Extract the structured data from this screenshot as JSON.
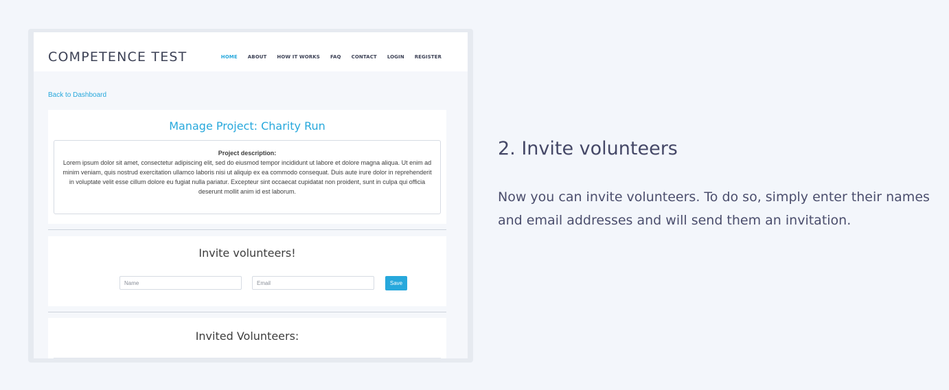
{
  "screenshot": {
    "logo": "COMPETENCE TEST",
    "nav": [
      "HOME",
      "ABOUT",
      "HOW IT WORKS",
      "FAQ",
      "CONTACT",
      "LOGIN",
      "REGISTER"
    ],
    "active_nav": "HOME",
    "back_link": "Back to Dashboard",
    "project": {
      "title": "Manage Project: Charity Run",
      "description_heading": "Project description:",
      "description_text": "Lorem ipsum dolor sit amet, consectetur adipiscing elit, sed do eiusmod tempor incididunt ut labore et dolore magna aliqua. Ut enim ad minim veniam, quis nostrud exercitation ullamco laboris nisi ut aliquip ex ea commodo consequat. Duis aute irure dolor in reprehenderit in voluptate velit esse cillum dolore eu fugiat nulla pariatur. Excepteur sint occaecat cupidatat non proident, sunt in culpa qui officia deserunt mollit anim id est laborum."
    },
    "invite": {
      "title": "Invite volunteers!",
      "name_placeholder": "Name",
      "email_placeholder": "Email",
      "save_label": "Save"
    },
    "invited": {
      "title": "Invited Volunteers:"
    }
  },
  "step": {
    "title": "2. Invite volunteers",
    "text": "Now you can invite volunteers. To do so, simply enter their names and email addresses and will send them an invitation."
  },
  "colors": {
    "page_background": "#f3f6fb",
    "accent": "#27a8dc",
    "heading_text": "#454867",
    "body_text": "#4b4e6d"
  }
}
